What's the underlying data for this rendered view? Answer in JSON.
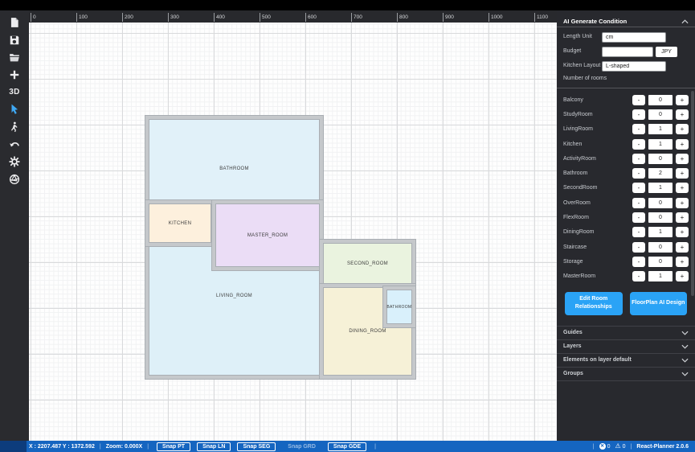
{
  "toolbar": {
    "icons": [
      {
        "name": "new-file-icon"
      },
      {
        "name": "save-icon"
      },
      {
        "name": "open-folder-icon"
      },
      {
        "name": "add-plus-icon"
      },
      {
        "name": "3d-view-icon",
        "label": "3D"
      },
      {
        "name": "pointer-icon"
      },
      {
        "name": "first-person-walk-icon"
      },
      {
        "name": "undo-icon"
      },
      {
        "name": "settings-gear-icon"
      },
      {
        "name": "aperture-world-icon"
      }
    ]
  },
  "ruler": {
    "ticks": [
      "0",
      "100",
      "200",
      "300",
      "400",
      "500",
      "600",
      "700",
      "800",
      "900",
      "1000",
      "1100"
    ]
  },
  "floorplan": {
    "wall_color": "#c5c8cb",
    "rooms": [
      {
        "label": "BATHROOM",
        "fill": "#e1f1f9"
      },
      {
        "label": "KITCHEN",
        "fill": "#fdf0dd"
      },
      {
        "label": "MASTER_ROOM",
        "fill": "#ebddf6"
      },
      {
        "label": "LIVING_ROOM",
        "fill": "#def0f8"
      },
      {
        "label": "SECOND_ROOM",
        "fill": "#eaf3df"
      },
      {
        "label": "DINING_ROOM",
        "fill": "#f6f1d7"
      },
      {
        "label": "BATHROOM",
        "fill": "#d9f0fb"
      }
    ]
  },
  "panel": {
    "title": "AI Generate Condition",
    "fields": {
      "length_unit_label": "Length Unit",
      "length_unit_value": "cm",
      "budget_label": "Budget",
      "budget_value": "",
      "budget_currency": "JPY",
      "kitchen_layout_label": "Kitchen Layout",
      "kitchen_layout_value": "L-shaped",
      "rooms_heading": "Number of rooms"
    },
    "minus_label": "-",
    "plus_label": "+",
    "counters": [
      {
        "label": "Balcony",
        "value": "0"
      },
      {
        "label": "StudyRoom",
        "value": "0"
      },
      {
        "label": "LivingRoom",
        "value": "1"
      },
      {
        "label": "Kitchen",
        "value": "1"
      },
      {
        "label": "ActivityRoom",
        "value": "0"
      },
      {
        "label": "Bathroom",
        "value": "2"
      },
      {
        "label": "SecondRoom",
        "value": "1"
      },
      {
        "label": "OverRoom",
        "value": "0"
      },
      {
        "label": "FlexRoom",
        "value": "0"
      },
      {
        "label": "DiningRoom",
        "value": "1"
      },
      {
        "label": "Staircase",
        "value": "0"
      },
      {
        "label": "Storage",
        "value": "0"
      },
      {
        "label": "MasterRoom",
        "value": "1"
      }
    ],
    "buttons": {
      "edit_room_relationships": "Edit Room Relationships",
      "floorplan_ai_design": "FloorPlan AI Design"
    },
    "sections": [
      {
        "label": "Guides"
      },
      {
        "label": "Layers"
      },
      {
        "label": "Elements on layer default"
      },
      {
        "label": "Groups"
      }
    ]
  },
  "statusbar": {
    "coordinates": "X : 2207.487 Y : 1372.592",
    "zoom": "Zoom: 0.000X",
    "snaps": [
      {
        "label": "Snap PT",
        "active": true
      },
      {
        "label": "Snap LN",
        "active": true
      },
      {
        "label": "Snap SEG",
        "active": true
      },
      {
        "label": "Snap GRD",
        "active": false
      },
      {
        "label": "Snap GDE",
        "active": true
      }
    ],
    "error_count": "0",
    "warning_count": "0",
    "app_version": "React-Planner 2.0.6"
  },
  "colors": {
    "accent_blue": "#2aa3f6",
    "statusbar_blue": "#1565c0",
    "pointer_blue": "#3fa9f5",
    "panel_bg": "#28292e"
  }
}
